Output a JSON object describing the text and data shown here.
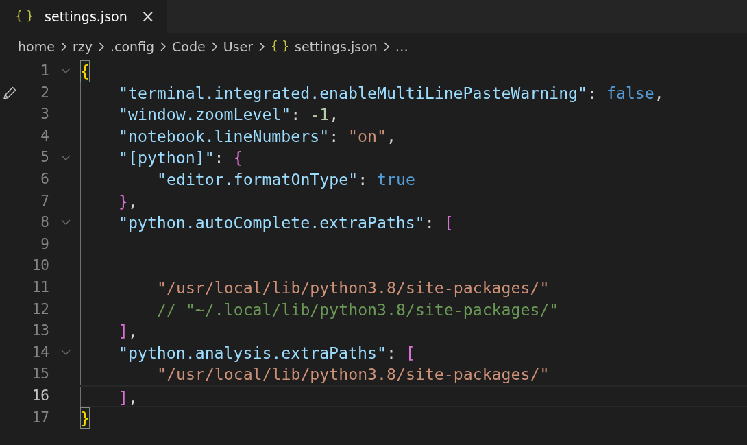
{
  "tab": {
    "icon": "{ }",
    "label": "settings.json",
    "close": "×",
    "selected": true
  },
  "breadcrumbs": [
    {
      "label": "home"
    },
    {
      "label": "rzy"
    },
    {
      "label": ".config"
    },
    {
      "label": "Code"
    },
    {
      "label": "User"
    },
    {
      "icon": "{ }",
      "label": "settings.json"
    },
    {
      "label": "…"
    }
  ],
  "lines": [
    {
      "number": "1",
      "foldable": true,
      "current": false,
      "edited": false,
      "tokens": [
        {
          "kind": "bracket1",
          "text": "{",
          "matched": true
        }
      ]
    },
    {
      "number": "2",
      "foldable": false,
      "current": false,
      "edited": true,
      "guides": [
        {
          "active": true
        }
      ],
      "tokens": [
        {
          "kind": "key",
          "text": "\"terminal.integrated.enableMultiLinePasteWarning\""
        },
        {
          "kind": "punct",
          "text": ": "
        },
        {
          "kind": "bool",
          "text": "false"
        },
        {
          "kind": "punct",
          "text": ","
        }
      ]
    },
    {
      "number": "3",
      "foldable": false,
      "current": false,
      "edited": false,
      "guides": [
        {
          "active": true
        }
      ],
      "tokens": [
        {
          "kind": "key",
          "text": "\"window.zoomLevel\""
        },
        {
          "kind": "punct",
          "text": ": "
        },
        {
          "kind": "number",
          "text": "-1"
        },
        {
          "kind": "punct",
          "text": ","
        }
      ]
    },
    {
      "number": "4",
      "foldable": false,
      "current": false,
      "edited": false,
      "guides": [
        {
          "active": true
        }
      ],
      "tokens": [
        {
          "kind": "key",
          "text": "\"notebook.lineNumbers\""
        },
        {
          "kind": "punct",
          "text": ": "
        },
        {
          "kind": "string",
          "text": "\"on\""
        },
        {
          "kind": "punct",
          "text": ","
        }
      ]
    },
    {
      "number": "5",
      "foldable": true,
      "current": false,
      "edited": false,
      "guides": [
        {
          "active": true
        }
      ],
      "tokens": [
        {
          "kind": "key",
          "text": "\"[python]\""
        },
        {
          "kind": "punct",
          "text": ": "
        },
        {
          "kind": "bracket2",
          "text": "{"
        }
      ]
    },
    {
      "number": "6",
      "foldable": false,
      "current": false,
      "edited": false,
      "guides": [
        {
          "active": true
        },
        {
          "active": false
        }
      ],
      "tokens": [
        {
          "kind": "key",
          "text": "\"editor.formatOnType\""
        },
        {
          "kind": "punct",
          "text": ": "
        },
        {
          "kind": "bool",
          "text": "true"
        }
      ]
    },
    {
      "number": "7",
      "foldable": false,
      "current": false,
      "edited": false,
      "guides": [
        {
          "active": true
        }
      ],
      "tokens": [
        {
          "kind": "bracket2",
          "text": "}"
        },
        {
          "kind": "punct",
          "text": ","
        }
      ]
    },
    {
      "number": "8",
      "foldable": true,
      "current": false,
      "edited": false,
      "guides": [
        {
          "active": true
        }
      ],
      "tokens": [
        {
          "kind": "key",
          "text": "\"python.autoComplete.extraPaths\""
        },
        {
          "kind": "punct",
          "text": ": "
        },
        {
          "kind": "bracket2",
          "text": "["
        }
      ]
    },
    {
      "number": "9",
      "foldable": false,
      "current": false,
      "edited": false,
      "guides": [
        {
          "active": true
        },
        {
          "active": false
        }
      ]
    },
    {
      "number": "10",
      "foldable": false,
      "current": false,
      "edited": false,
      "guides": [
        {
          "active": true
        },
        {
          "active": false
        }
      ]
    },
    {
      "number": "11",
      "foldable": false,
      "current": false,
      "edited": false,
      "guides": [
        {
          "active": true
        },
        {
          "active": false
        }
      ],
      "tokens": [
        {
          "kind": "string",
          "text": "\"/usr/local/lib/python3.8/site-packages/\""
        }
      ]
    },
    {
      "number": "12",
      "foldable": false,
      "current": false,
      "edited": false,
      "guides": [
        {
          "active": true
        },
        {
          "active": false
        }
      ],
      "tokens": [
        {
          "kind": "comment",
          "text": "// \"~/.local/lib/python3.8/site-packages/\""
        }
      ]
    },
    {
      "number": "13",
      "foldable": false,
      "current": false,
      "edited": false,
      "guides": [
        {
          "active": true
        }
      ],
      "tokens": [
        {
          "kind": "bracket2",
          "text": "]"
        },
        {
          "kind": "punct",
          "text": ","
        }
      ]
    },
    {
      "number": "14",
      "foldable": true,
      "current": false,
      "edited": false,
      "guides": [
        {
          "active": true
        }
      ],
      "tokens": [
        {
          "kind": "key",
          "text": "\"python.analysis.extraPaths\""
        },
        {
          "kind": "punct",
          "text": ": "
        },
        {
          "kind": "bracket2",
          "text": "["
        }
      ]
    },
    {
      "number": "15",
      "foldable": false,
      "current": false,
      "edited": false,
      "guides": [
        {
          "active": true
        },
        {
          "active": false
        }
      ],
      "tokens": [
        {
          "kind": "string",
          "text": "\"/usr/local/lib/python3.8/site-packages/\""
        }
      ]
    },
    {
      "number": "16",
      "foldable": false,
      "current": true,
      "edited": false,
      "guides": [
        {
          "active": true
        }
      ],
      "tokens": [
        {
          "kind": "bracket2",
          "text": "]"
        },
        {
          "kind": "punct",
          "text": ","
        }
      ]
    },
    {
      "number": "17",
      "foldable": false,
      "current": false,
      "edited": false,
      "tokens": [
        {
          "kind": "bracket1",
          "text": "}",
          "matched": true
        }
      ]
    }
  ]
}
